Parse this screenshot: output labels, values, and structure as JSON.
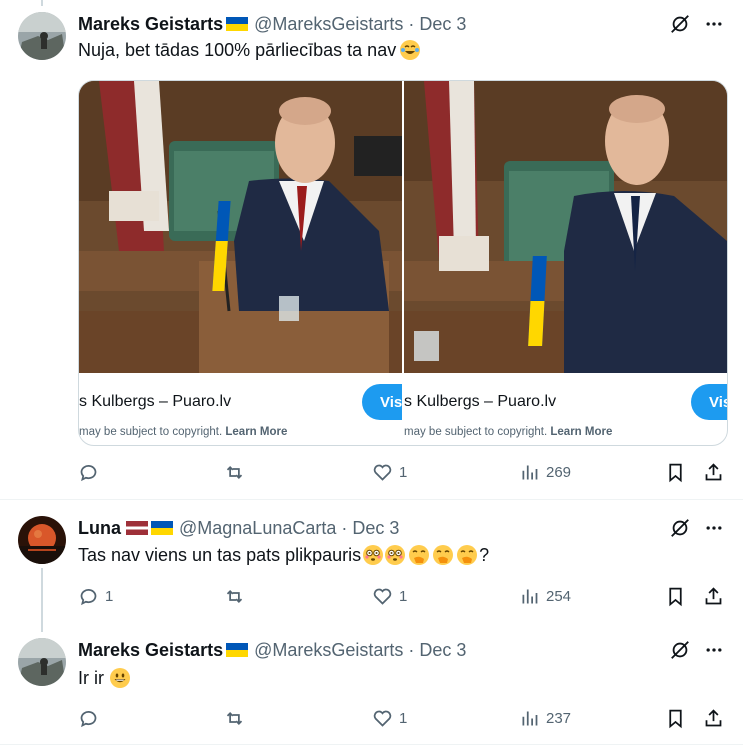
{
  "tweets": [
    {
      "name": "Mareks Geistarts",
      "handle": "@MareksGeistarts",
      "separator": "·",
      "date": "Dec 3",
      "text": "Nuja, bet tādas 100% pārliecības ta nav",
      "media": {
        "cards": [
          {
            "title": "s Kulbergs – Puaro.lv",
            "visit_label": "Vis",
            "copyright": "may be subject to copyright.",
            "learn_more": "Learn More"
          },
          {
            "title": "s Kulbergs – Puaro.lv",
            "visit_label": "Vis",
            "copyright": "may be subject to copyright.",
            "learn_more": "Learn More"
          }
        ]
      },
      "actions": {
        "replies": "",
        "retweets": "",
        "likes": "1",
        "views": "269"
      }
    },
    {
      "name": "Luna",
      "handle": "@MagnaLunaCarta",
      "separator": "·",
      "date": "Dec 3",
      "text": "Tas nav viens un tas pats plikpauris",
      "text_suffix": "?",
      "actions": {
        "replies": "1",
        "retweets": "",
        "likes": "1",
        "views": "254"
      }
    },
    {
      "name": "Mareks Geistarts",
      "handle": "@MareksGeistarts",
      "separator": "·",
      "date": "Dec 3",
      "text": "Ir ir",
      "actions": {
        "replies": "",
        "retweets": "",
        "likes": "1",
        "views": "237"
      }
    }
  ],
  "colors": {
    "text": "#0f1419",
    "secondary": "#536471",
    "accent": "#1d9bf0",
    "border": "#cfd9de"
  },
  "icons": [
    "grok-icon",
    "more-icon",
    "reply-icon",
    "retweet-icon",
    "like-icon",
    "views-icon",
    "bookmark-icon",
    "share-icon"
  ]
}
